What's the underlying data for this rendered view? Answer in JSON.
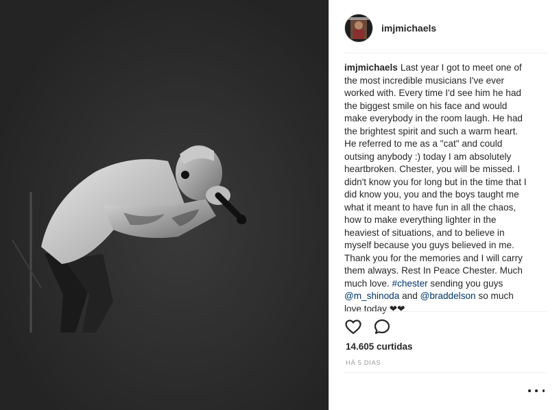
{
  "post": {
    "username": "imjmichaels",
    "caption": {
      "username": "imjmichaels",
      "text_before": "Last year I got to meet one of the most incredible musicians I've ever worked with. Every time I'd see him he had the biggest smile on his face and would make everybody in the room laugh. He had the brightest spirit and such a warm heart. He referred to me as a \"cat\" and could outsing anybody :) today I am absolutely heartbroken. Chester, you will be missed. I didn't know you for long but in the time that I did know you, you and the boys taught me what it meant to have fun in all the chaos, how to make everything lighter in the heaviest of situations, and to believe in myself because you guys believed in me. Thank you for the memories and I will carry them always. Rest In Peace Chester. Much much love. ",
      "hashtag": "#chester",
      "text_middle": " sending you guys ",
      "mention_1": "@m_shinoda",
      "text_and": " and ",
      "mention_2": "@braddelson",
      "text_after": " so much love today ❤❤"
    },
    "likes_label": "14.605 curtidas",
    "timestamp": "HÁ 5 DIAS"
  },
  "icons": {
    "like": "heart-outline-icon",
    "comment": "comment-bubble-icon",
    "more": "more-options-icon"
  },
  "colors": {
    "photo_background": "#2b2b2b",
    "text": "#262626",
    "link": "#003569",
    "muted": "#999999",
    "divider": "#efefef"
  }
}
